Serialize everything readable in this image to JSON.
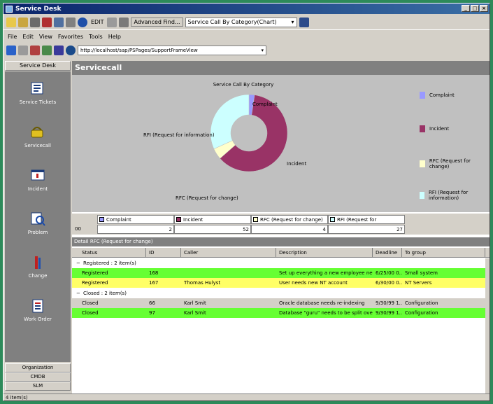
{
  "window": {
    "title": "Service Desk"
  },
  "toolbar": {
    "edit_label": "EDIT",
    "advanced_find_label": "Advanced Find...",
    "view_combo_value": "Service Call By Category(Chart)"
  },
  "menu": [
    "File",
    "Edit",
    "View",
    "Favorites",
    "Tools",
    "Help"
  ],
  "address": {
    "url": "http://localhost/sap/PSPages/SupportFrameView"
  },
  "sidebar": {
    "header": "Service Desk",
    "items": [
      {
        "label": "Service Tickets",
        "icon": "service-tickets-icon"
      },
      {
        "label": "Servicecall",
        "icon": "servicecall-icon"
      },
      {
        "label": "Incident",
        "icon": "incident-icon"
      },
      {
        "label": "Problem",
        "icon": "problem-icon"
      },
      {
        "label": "Change",
        "icon": "change-icon"
      },
      {
        "label": "Work Order",
        "icon": "work-order-icon"
      }
    ],
    "footer": [
      "Organization",
      "CMDB",
      "SLM"
    ]
  },
  "main": {
    "title": "Servicecall"
  },
  "chart_data": {
    "type": "pie",
    "title": "Service Call By Category",
    "categories": [
      "Complaint",
      "Incident",
      "RFC (Request for change)",
      "RFI (Request for information)"
    ],
    "values": [
      2,
      52,
      4,
      27
    ],
    "colors": [
      "#9999ff",
      "#993366",
      "#ffffcc",
      "#ccffff"
    ],
    "slice_labels": [
      "Complaint",
      "Incident",
      "RFC (Request for change)",
      "RFI (Request for information)"
    ],
    "legend_labels": [
      "Complaint",
      "Incident",
      "RFC (Request for change)",
      "RFI (Request for information)"
    ],
    "legend_position": "right"
  },
  "data_strip": {
    "row_label": "00",
    "headers": [
      "Complaint",
      "Incident",
      "RFC (Request for change)",
      "RFI (Request for information)"
    ],
    "values": [
      "2",
      "52",
      "4",
      "27"
    ]
  },
  "detail": {
    "title": "Detail RFC (Request for change)",
    "columns": [
      "Status",
      "ID",
      "Caller",
      "Description",
      "Deadline",
      "To group"
    ],
    "groups": [
      {
        "label": "Registered : 2 item(s)",
        "rows": [
          {
            "status": "Registered",
            "id": "168",
            "caller": "",
            "description": "Set up everything a new employee nee...",
            "deadline": "6/25/00 0...",
            "group": "Small system",
            "color": "#66ff33"
          },
          {
            "status": "Registered",
            "id": "167",
            "caller": "Thomas Hulyst",
            "description": "User needs new NT account",
            "deadline": "6/30/00 0...",
            "group": "NT Servers",
            "color": "#ffff66"
          }
        ]
      },
      {
        "label": "Closed : 2 item(s)",
        "rows": [
          {
            "status": "Closed",
            "id": "66",
            "caller": "Karl Smit",
            "description": "Oracle database needs re-indexing",
            "deadline": "9/30/99 1...",
            "group": "Configuration",
            "color": "#d4d0c8"
          },
          {
            "status": "Closed",
            "id": "97",
            "caller": "Karl Smit",
            "description": "Database \"guru\" needs to be split over...",
            "deadline": "9/30/99 1...",
            "group": "Configuration",
            "color": "#66ff33"
          }
        ]
      }
    ]
  },
  "status_bar": {
    "text": "4 item(s)"
  }
}
